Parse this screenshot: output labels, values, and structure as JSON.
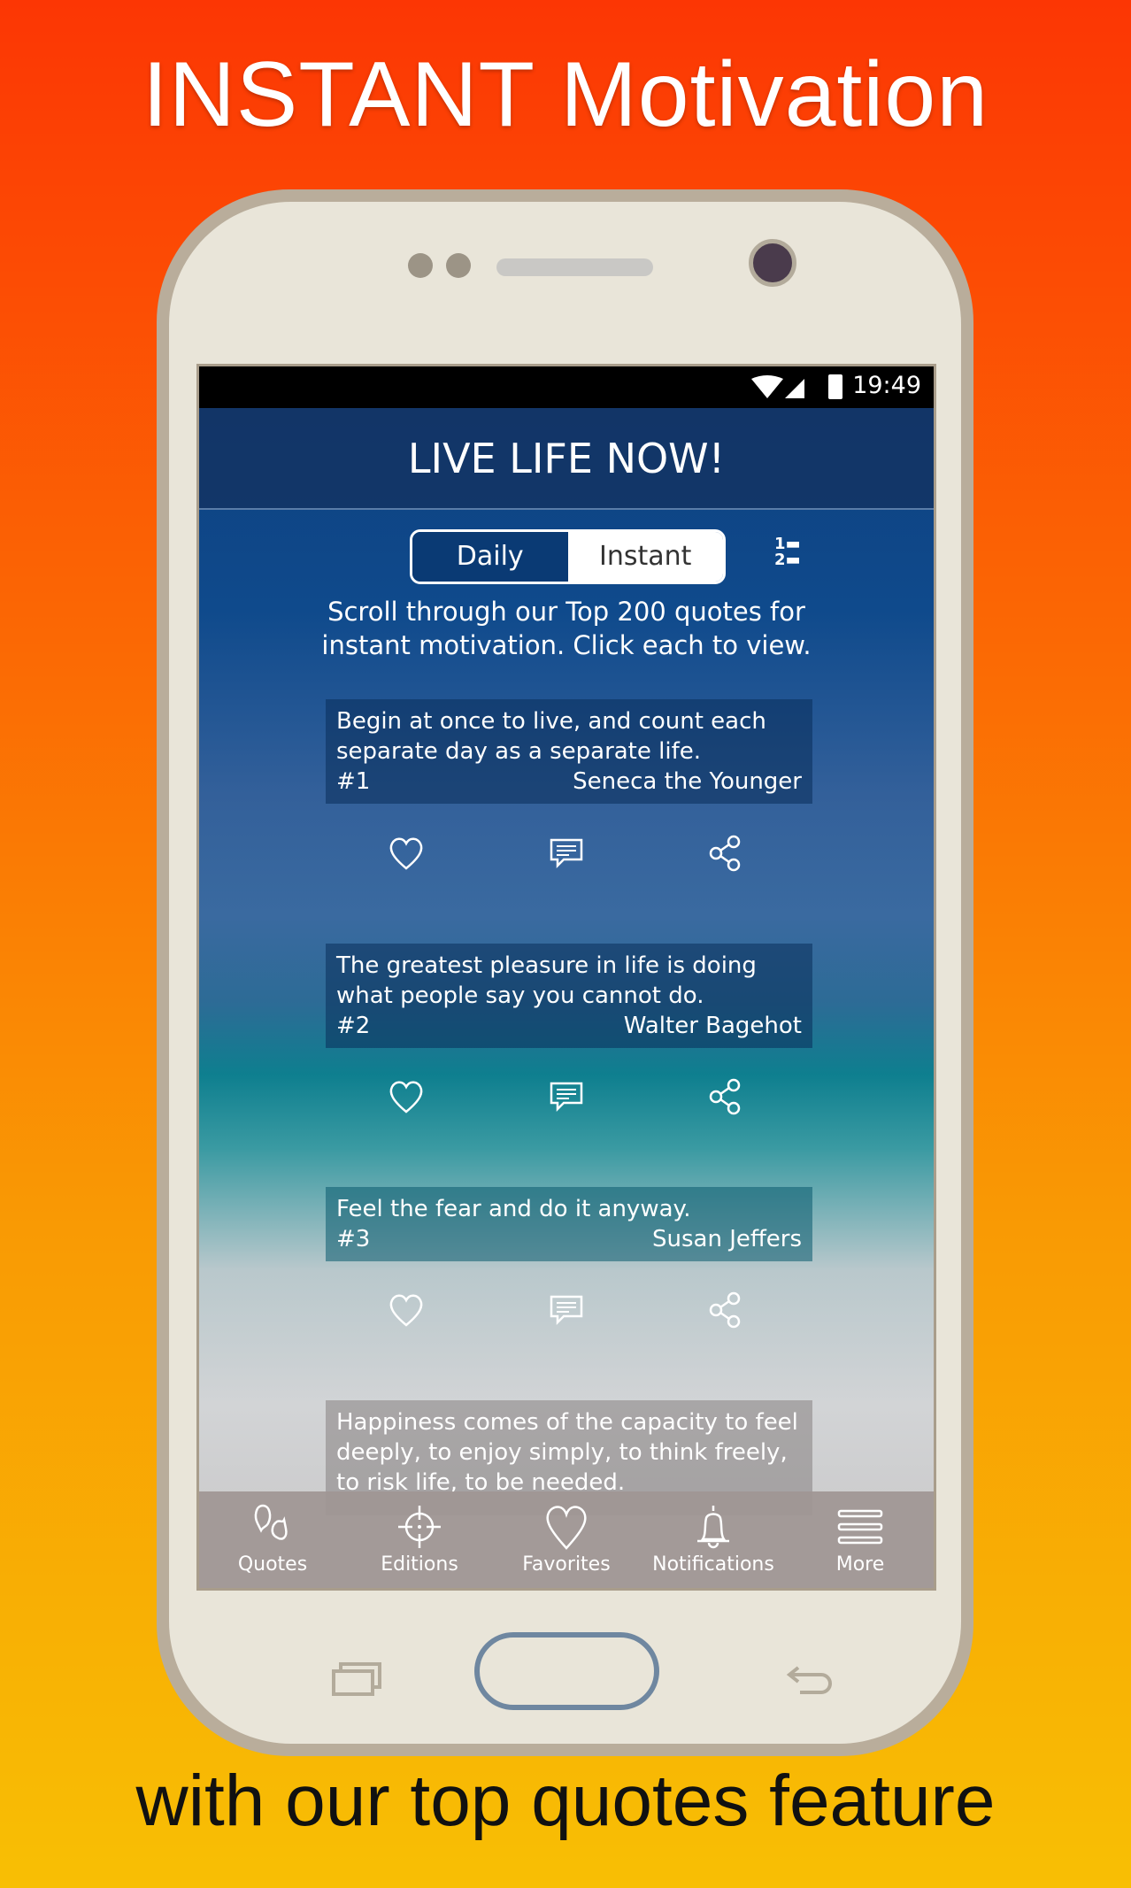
{
  "promo": {
    "headline": "INSTANT Motivation",
    "footer": "with our top quotes feature"
  },
  "status_bar": {
    "time": "19:49",
    "icons": [
      "wifi-icon",
      "signal-icon",
      "battery-icon"
    ]
  },
  "header": {
    "title": "LIVE LIFE NOW!"
  },
  "toggle": {
    "daily": "Daily",
    "instant": "Instant",
    "selected": "Daily"
  },
  "intro": {
    "line1": "Scroll through our Top 200 quotes for",
    "line2": "instant motivation. Click each to view."
  },
  "quotes": [
    {
      "text": "Begin at once to live, and count each separate day as a separate life.",
      "number": "#1",
      "author": "Seneca the Younger"
    },
    {
      "text": "The greatest pleasure in life is doing what people say you cannot do.",
      "number": "#2",
      "author": "Walter Bagehot"
    },
    {
      "text": "Feel the fear and do it anyway.",
      "number": "#3",
      "author": "Susan Jeffers"
    },
    {
      "text": "Happiness comes of the capacity to feel deeply, to enjoy simply, to think freely, to risk life, to be needed.",
      "number": "",
      "author": ""
    }
  ],
  "nav": [
    {
      "label": "Quotes",
      "icon": "quotes-icon"
    },
    {
      "label": "Editions",
      "icon": "crosshair-icon"
    },
    {
      "label": "Favorites",
      "icon": "heart-icon"
    },
    {
      "label": "Notifications",
      "icon": "bell-icon"
    },
    {
      "label": "More",
      "icon": "menu-icon"
    }
  ]
}
